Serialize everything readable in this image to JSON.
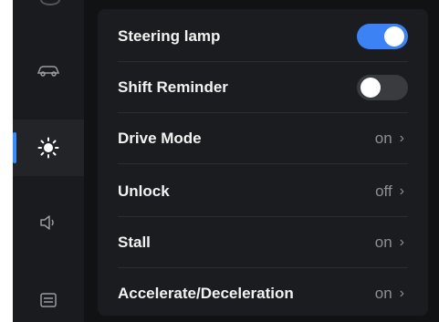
{
  "sidebar": {
    "items": [
      {
        "icon": "car-icon",
        "active": false
      },
      {
        "icon": "sun-icon",
        "active": true
      },
      {
        "icon": "speaker-icon",
        "active": false
      },
      {
        "icon": "card-icon",
        "active": false
      }
    ]
  },
  "settings": {
    "rows": [
      {
        "label": "Steering lamp",
        "type": "toggle",
        "enabled": true
      },
      {
        "label": "Shift Reminder",
        "type": "toggle",
        "enabled": false
      },
      {
        "label": "Drive Mode",
        "type": "value",
        "value": "on"
      },
      {
        "label": "Unlock",
        "type": "value",
        "value": "off"
      },
      {
        "label": "Stall",
        "type": "value",
        "value": "on"
      },
      {
        "label": "Accelerate/Deceleration",
        "type": "value",
        "value": "on"
      }
    ]
  },
  "colors": {
    "accent": "#3d82f5",
    "background": "#111214",
    "panel": "#1b1c1f",
    "text": "#f2f2f2",
    "muted": "#8e8f93"
  },
  "icons": {
    "chevron": "›"
  }
}
